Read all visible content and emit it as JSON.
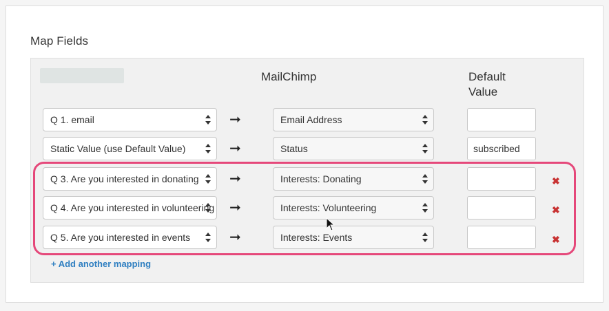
{
  "section": {
    "title": "Map Fields"
  },
  "columns": {
    "mailchimp": "MailChimp",
    "default_value": "Default Value"
  },
  "rows": [
    {
      "source": "Q 1. email",
      "target": "Email Address",
      "default": "",
      "deletable": false
    },
    {
      "source": "Static Value (use Default Value)",
      "target": "Status",
      "default": "subscribed",
      "deletable": false
    },
    {
      "source": "Q 3. Are you interested in donating",
      "target": "Interests: Donating",
      "default": "",
      "deletable": true
    },
    {
      "source": "Q 4. Are you interested in volunteering",
      "target": "Interests: Volunteering",
      "default": "",
      "deletable": true
    },
    {
      "source": "Q 5. Are you interested in events",
      "target": "Interests: Events",
      "default": "",
      "deletable": true
    }
  ],
  "arrow_glyph": "➞",
  "delete_glyph": "✖",
  "add_link": "+ Add another mapping",
  "colors": {
    "highlight": "#e5487a",
    "delete": "#c83232",
    "link": "#2f7fc1"
  }
}
